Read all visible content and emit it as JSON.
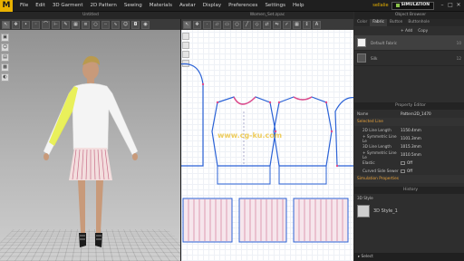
{
  "app": {
    "logo": "M"
  },
  "menu": [
    "File",
    "Edit",
    "3D Garment",
    "2D Pattern",
    "Sewing",
    "Materials",
    "Avatar",
    "Display",
    "Preferences",
    "Settings",
    "Help"
  ],
  "user": {
    "name": "sellalie",
    "simulation_label": "SIMULATION"
  },
  "window_controls": [
    "–",
    "□",
    "✕"
  ],
  "panel_titles": {
    "left": "Untitled",
    "center": "Women_Set.zpac",
    "right_top": "Object Browser",
    "property": "Property Editor",
    "history": "History"
  },
  "object_browser": {
    "tabs": [
      "Color",
      "Fabric",
      "Button",
      "Buttonhole"
    ],
    "active_tab": "Fabric",
    "toolbar": [
      "+ Add",
      "Copy"
    ],
    "items": [
      {
        "name": "Default Fabric",
        "count": "10"
      },
      {
        "name": "Silk",
        "count": "12"
      }
    ]
  },
  "property_editor": {
    "name": {
      "label": "Name",
      "value": "Pattern2D_1470"
    },
    "section_selected_line": "Selected Line",
    "rows": [
      {
        "label": "2D Line Length",
        "value": "1150.4mm"
      },
      {
        "label": "+ Symmetric Line Le",
        "value": "1101.3mm"
      },
      {
        "label": "3D Line Length",
        "value": "1015.3mm"
      },
      {
        "label": "+ Symmetric Line Le",
        "value": "1010.5mm"
      },
      {
        "label": "Elastic",
        "value": "Off"
      },
      {
        "label": "Curved Side Sewer",
        "value": "Off"
      }
    ],
    "section_simulation": "Simulation Properties"
  },
  "history": {
    "mode_label": "3D Style",
    "style_name": "3D Style_1",
    "select_label": "Select"
  },
  "watermark": {
    "center": "www.cg-ku.com"
  },
  "colors": {
    "accent": "#e9b200",
    "pattern_line": "#2b62d6",
    "seam_pink": "#e04a8a",
    "pattern_edge": "#7a7ab0"
  }
}
